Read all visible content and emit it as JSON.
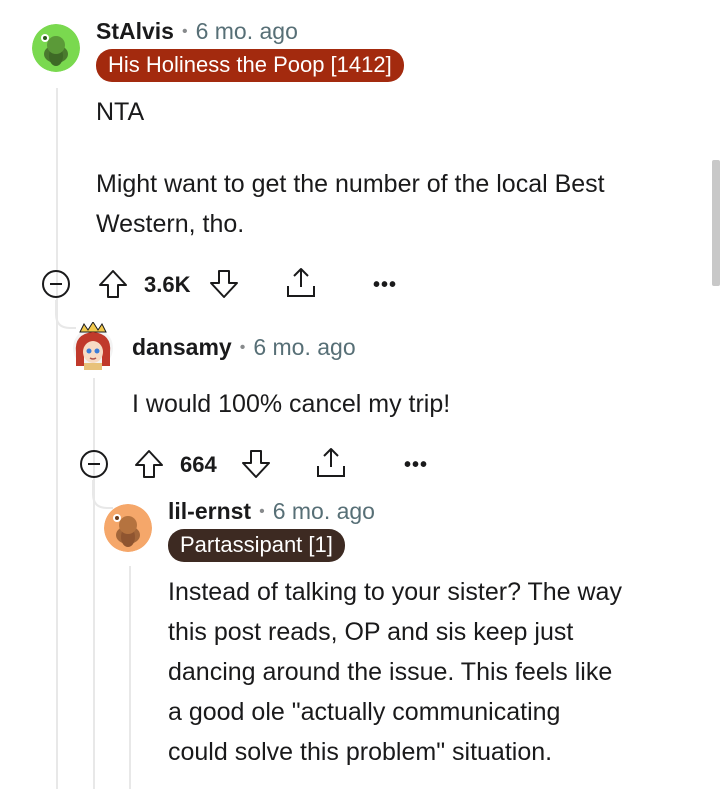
{
  "comments": [
    {
      "username": "StAlvis",
      "time": "6 mo. ago",
      "flair": "His Holiness the Poop [1412]",
      "flair_color": "#a32a0e",
      "avatar_bg": "#7ad94f",
      "body_lines": [
        "NTA",
        "",
        "Might want to get the number of the local Best",
        "Western, tho."
      ],
      "score": "3.6K",
      "more": "•••"
    },
    {
      "username": "dansamy",
      "time": "6 mo. ago",
      "body_lines": [
        "I would 100% cancel my trip!"
      ],
      "score": "664",
      "more": "•••"
    },
    {
      "username": "lil-ernst",
      "time": "6 mo. ago",
      "flair": "Partassipant [1]",
      "flair_color": "#3d2a22",
      "avatar_bg": "#f5a76a",
      "body_lines": [
        "Instead of talking to your sister? The way",
        "this post reads, OP and sis keep just",
        "dancing around the issue. This feels like",
        "a good ole \"actually communicating",
        "could solve this problem\" situation."
      ]
    }
  ],
  "separator": "•"
}
